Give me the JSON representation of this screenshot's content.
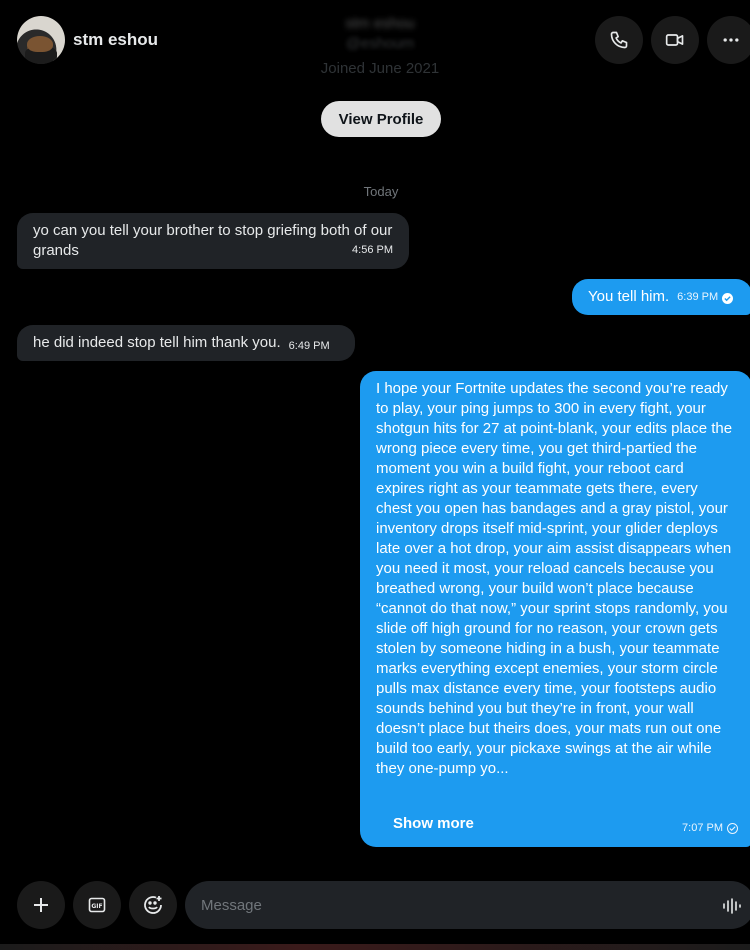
{
  "header": {
    "username": "stm eshou",
    "display_name_blurred": "stm eshou",
    "handle_blurred": "@eshoum",
    "joined": "Joined June 2021",
    "icons": {
      "call": "phone-icon",
      "video": "video-icon",
      "more": "more-icon"
    }
  },
  "view_profile_label": "View Profile",
  "date_separator": "Today",
  "messages": [
    {
      "direction": "in",
      "text": "yo can you tell your brother to stop griefing both of our grands",
      "time": "4:56 PM"
    },
    {
      "direction": "out",
      "text": "You tell him.",
      "time": "6:39 PM",
      "status": "read"
    },
    {
      "direction": "in",
      "text": "he did indeed stop tell him thank you.",
      "time": "6:49 PM"
    },
    {
      "direction": "out",
      "text": "I hope your Fortnite updates the second you’re ready to play, your ping jumps to 300 in every fight, your shotgun hits for 27 at point-blank, your edits place the wrong piece every time, you get third-partied the moment you win a build fight, your reboot card expires right as your teammate gets there, every chest you open has bandages and a gray pistol, your inventory drops itself mid-sprint, your glider deploys late over a hot drop, your aim assist disappears when you need it most, your reload cancels because you breathed wrong, your build won’t place because “cannot do that now,” your sprint stops randomly, you slide off high ground for no reason, your crown gets stolen by someone hiding in a bush, your teammate marks everything except enemies, your storm circle pulls max distance every time, your footsteps audio sounds behind you but they’re in front, your wall doesn’t place but theirs does, your mats run out one build too early, your pickaxe swings at the air while they one-pump yo...",
      "show_more": "Show more",
      "time": "7:07 PM",
      "status": "sent"
    }
  ],
  "composer": {
    "placeholder": "Message",
    "icons": {
      "add": "plus-icon",
      "gif": "gif-icon",
      "emoji": "emoji-icon",
      "voice": "voice-icon"
    }
  },
  "colors": {
    "background": "#000000",
    "incoming_bubble": "#202327",
    "outgoing_bubble": "#1d9bf0",
    "button_bg": "#1a1a1a"
  }
}
